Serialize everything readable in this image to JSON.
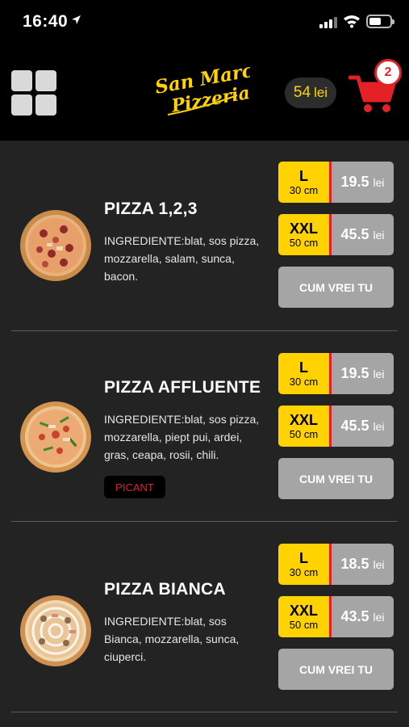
{
  "status_bar": {
    "time": "16:40"
  },
  "header": {
    "logo_text": "San Marco Pizzeria",
    "balance": {
      "amount": "54",
      "unit": "lei"
    },
    "cart_count": "2"
  },
  "colors": {
    "accent_yellow": "#ffd200",
    "accent_red": "#e32126",
    "background": "#232323"
  },
  "pizzas": [
    {
      "name": "PIZZA 1,2,3",
      "ingredients": "INGREDIENTE:blat, sos pizza, mozzarella, salam, sunca, bacon.",
      "tag": "",
      "sizes": [
        {
          "label": "L",
          "cm": "30 cm",
          "price": "19.5",
          "unit": "lei"
        },
        {
          "label": "XXL",
          "cm": "50 cm",
          "price": "45.5",
          "unit": "lei"
        }
      ],
      "custom_label": "CUM VREI TU"
    },
    {
      "name": "PIZZA AFFLUENTE",
      "ingredients": "INGREDIENTE:blat, sos pizza, mozzarella, piept pui, ardei, gras, ceapa, rosii, chili.",
      "tag": "PICANT",
      "sizes": [
        {
          "label": "L",
          "cm": "30 cm",
          "price": "19.5",
          "unit": "lei"
        },
        {
          "label": "XXL",
          "cm": "50 cm",
          "price": "45.5",
          "unit": "lei"
        }
      ],
      "custom_label": "CUM VREI TU"
    },
    {
      "name": "PIZZA BIANCA",
      "ingredients": "INGREDIENTE:blat, sos Bianca, mozzarella, sunca, ciuperci.",
      "tag": "",
      "sizes": [
        {
          "label": "L",
          "cm": "30 cm",
          "price": "18.5",
          "unit": "lei"
        },
        {
          "label": "XXL",
          "cm": "50 cm",
          "price": "43.5",
          "unit": "lei"
        }
      ],
      "custom_label": "CUM VREI TU"
    }
  ]
}
